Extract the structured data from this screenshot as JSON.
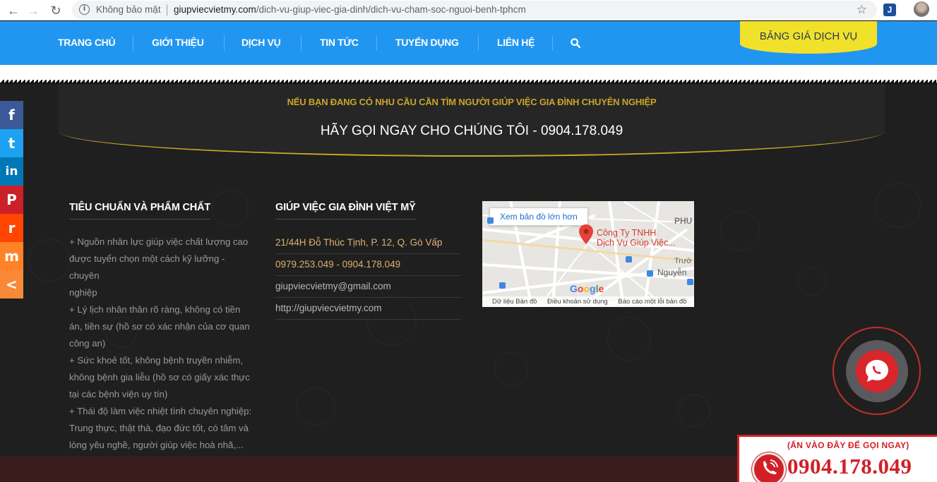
{
  "browser": {
    "security_label": "Không bảo mật",
    "url_domain": "giupviecvietmy.com",
    "url_path": "/dich-vu-giup-viec-gia-dinh/dich-vu-cham-soc-nguoi-benh-tphcm",
    "extension_letter": "J"
  },
  "nav": {
    "items": [
      "TRANG CHỦ",
      "GIỚI THIỆU",
      "DỊCH VỤ",
      "TIN TỨC",
      "TUYỂN DỤNG",
      "LIÊN HỆ"
    ],
    "price_button": "BẢNG GIÁ DỊCH VỤ"
  },
  "cta": {
    "subtitle": "NẾU BẠN ĐANG CÓ NHU CẦU CẦN TÌM NGƯỜI GIÚP VIỆC GIA ĐÌNH CHUYÊN NGHIỆP",
    "headline": "HÃY GỌI NGAY CHO CHÚNG TÔI - 0904.178.049"
  },
  "standards": {
    "title": "TIÊU CHUẨN VÀ PHẨM CHẤT",
    "lines": [
      "+ Nguồn nhân lực giúp việc chất lượng cao",
      "được tuyển chọn một cách kỹ lưỡng - chuyên",
      "nghiệp",
      "+ Lý lịch nhân thân rõ ràng, không có tiền",
      "án, tiền sự (hồ sơ có xác nhận của cơ quan",
      "công an)",
      "+ Sức khoẻ tốt, không bệnh truyền nhiễm,",
      "không bệnh gia liễu (hồ sơ có giấy xác thực",
      "tại các bệnh viện uy tín)",
      "+ Thái độ làm việc nhiệt tình chuyên nghiệp:",
      "Trung thực, thật thà, đạo đức tốt, có tâm và",
      "lòng yêu nghề, người giúp việc hoà nhã,..."
    ]
  },
  "contact": {
    "title": "GIÚP VIỆC GIA ĐÌNH VIỆT MỸ",
    "address": "21/44H Đỗ Thúc Tịnh, P. 12, Q. Gò Vấp",
    "phones": "0979.253.049 - 0904.178.049",
    "email": "giupviecvietmy@gmail.com",
    "website": "http://giupviecvietmy.com"
  },
  "map": {
    "view_larger": "Xem bản đồ lớn hơn",
    "place_line1": "Công Ty TNHH",
    "place_line2": "Dịch Vụ Giúp Việc...",
    "area_label": "PHU",
    "street1": "Trườ",
    "street2": "Nguyễn",
    "footer_data": "Dữ liệu Bản đồ",
    "footer_terms": "Điều khoản sử dụng",
    "footer_report": "Báo cáo một lỗi bản đồ",
    "google": [
      "G",
      "o",
      "o",
      "g",
      "l",
      "e"
    ]
  },
  "call": {
    "label": "(ẤN VÀO ĐÂY ĐỂ GỌI NGAY)",
    "number": "0904.178.049"
  },
  "social": [
    {
      "name": "facebook-icon",
      "glyph": "f",
      "color": "#3b5998"
    },
    {
      "name": "twitter-icon",
      "glyph": "t",
      "color": "#1da1f2"
    },
    {
      "name": "linkedin-icon",
      "glyph": "in",
      "color": "#0077b5"
    },
    {
      "name": "pinterest-icon",
      "glyph": "P",
      "color": "#cb2027"
    },
    {
      "name": "reddit-icon",
      "glyph": "r",
      "color": "#ff4500"
    },
    {
      "name": "mix-icon",
      "glyph": "m",
      "color": "#ff8226"
    },
    {
      "name": "share-icon",
      "glyph": "<",
      "color": "#f98937"
    }
  ]
}
